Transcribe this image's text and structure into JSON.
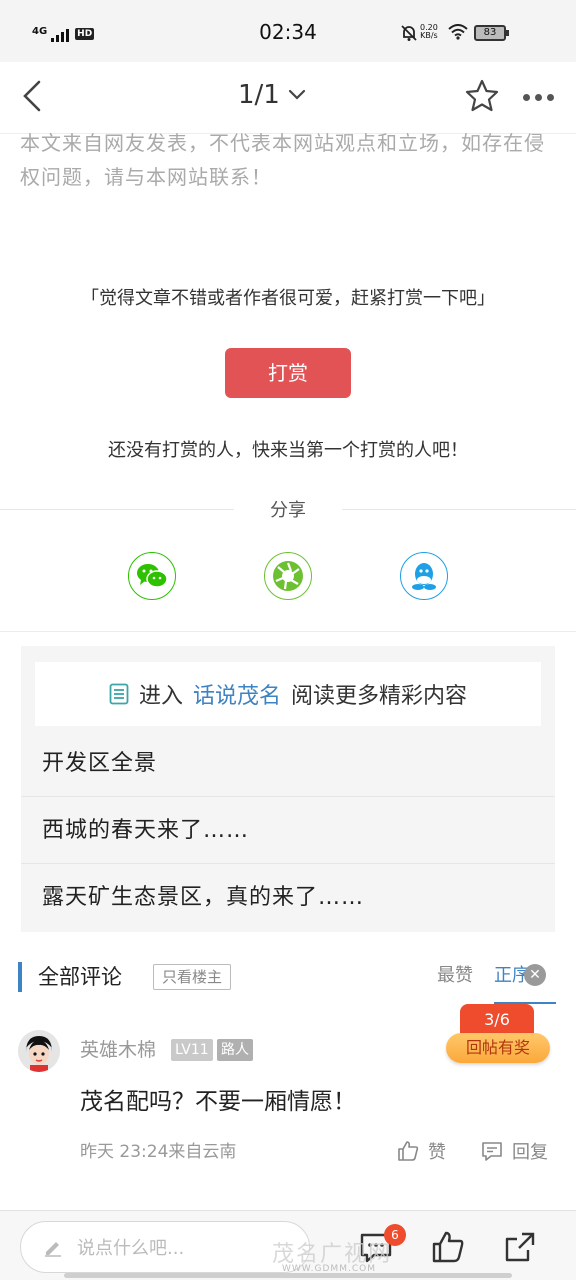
{
  "status_bar": {
    "network": "4G",
    "hd": "HD",
    "time": "02:34",
    "speed_value": "0.20",
    "speed_unit": "KB/s",
    "battery": "83"
  },
  "nav": {
    "page_indicator": "1/1"
  },
  "article": {
    "disclaimer": "本文来自网友发表，不代表本网站观点和立场，如存在侵权问题，请与本网站联系！"
  },
  "reward": {
    "tip": "「觉得文章不错或者作者很可爱，赶紧打赏一下吧」",
    "button_label": "打赏",
    "empty_text": "还没有打赏的人，快来当第一个打赏的人吧！"
  },
  "share": {
    "title": "分享",
    "items": [
      {
        "name": "wechat",
        "icon": "wechat-icon",
        "color": "#2dc100"
      },
      {
        "name": "moments",
        "icon": "moments-icon",
        "color": "#6cc133"
      },
      {
        "name": "qq",
        "icon": "qq-icon",
        "color": "#1ea0e6"
      }
    ]
  },
  "more": {
    "enter_prefix": "进入",
    "forum_name": "话说茂名",
    "enter_suffix": "阅读更多精彩内容",
    "items": [
      "开发区全景",
      "西城的春天来了……",
      "露天矿生态景区，真的来了……"
    ]
  },
  "comments": {
    "title": "全部评论",
    "only_author": "只看楼主",
    "sort_hot": "最赞",
    "sort_order": "正序",
    "reply_counter": "3/6",
    "reply_reward": "回帖有奖",
    "list": [
      {
        "user": "英雄木棉",
        "level": "LV11",
        "role": "路人",
        "text": "茂名配吗？不要一厢情愿！",
        "meta": "昨天 23:24来自云南",
        "like_label": "赞",
        "reply_label": "回复"
      }
    ]
  },
  "bottom": {
    "input_placeholder": "说点什么吧...",
    "comment_badge": "6",
    "watermark": "茂名广视网",
    "watermark_url": "WWW.GDMM.COM"
  },
  "colors": {
    "accent": "#3e83c3",
    "reward_button": "#e15355",
    "badge": "#ee4c2c"
  }
}
